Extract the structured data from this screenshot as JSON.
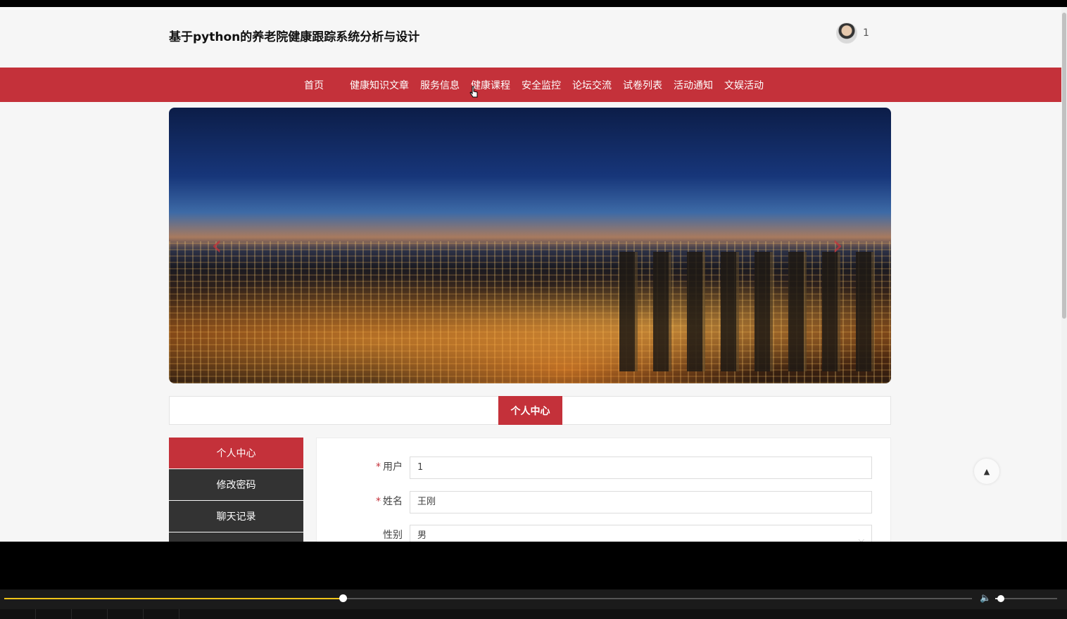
{
  "header": {
    "title": "基于python的养老院健康跟踪系统分析与设计",
    "username": "1"
  },
  "nav": {
    "items": [
      "首页",
      "健康知识文章",
      "服务信息",
      "健康课程",
      "安全监控",
      "论坛交流",
      "试卷列表",
      "活动通知",
      "文娱活动"
    ]
  },
  "banner": {
    "prev_icon": "chevron-left-icon",
    "next_icon": "chevron-right-icon"
  },
  "section": {
    "title": "个人中心"
  },
  "sidebar": {
    "items": [
      "个人中心",
      "修改密码",
      "聊天记录"
    ]
  },
  "form": {
    "fields": [
      {
        "label": "用户",
        "value": "1",
        "required": true
      },
      {
        "label": "姓名",
        "value": "王刚",
        "required": true
      },
      {
        "label": "性别",
        "value": "男",
        "required": false
      }
    ]
  },
  "player": {
    "progress": 0.35,
    "volume": 0.09
  },
  "colors": {
    "accent": "#c4313a",
    "sidebar": "#333333"
  }
}
